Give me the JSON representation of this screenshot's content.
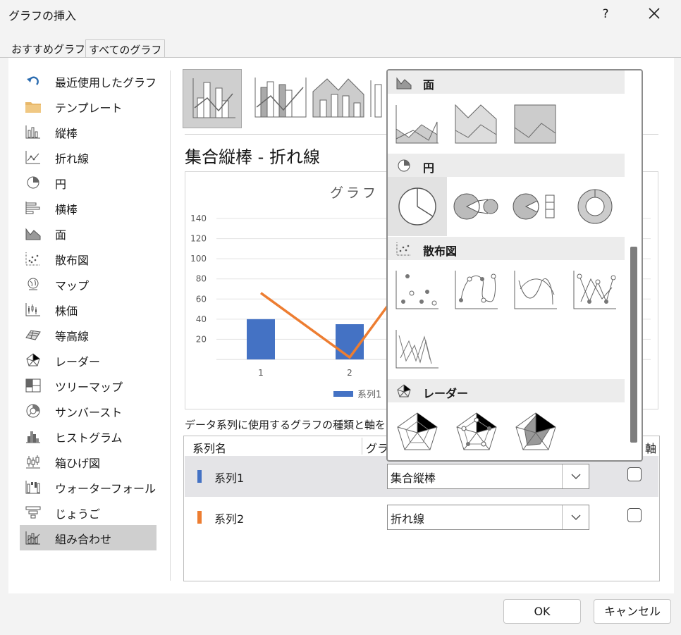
{
  "dialog": {
    "title": "グラフの挿入",
    "help": "?",
    "tabs": [
      "おすすめグラフ",
      "すべてのグラフ"
    ]
  },
  "sidebar": {
    "items": [
      {
        "label": "最近使用したグラフ",
        "icon": "recent-icon"
      },
      {
        "label": "テンプレート",
        "icon": "folder-icon"
      },
      {
        "label": "縦棒",
        "icon": "column-chart-icon"
      },
      {
        "label": "折れ線",
        "icon": "line-chart-icon"
      },
      {
        "label": "円",
        "icon": "pie-chart-icon"
      },
      {
        "label": "横棒",
        "icon": "bar-chart-icon"
      },
      {
        "label": "面",
        "icon": "area-chart-icon"
      },
      {
        "label": "散布図",
        "icon": "scatter-chart-icon"
      },
      {
        "label": "マップ",
        "icon": "map-chart-icon"
      },
      {
        "label": "株価",
        "icon": "stock-chart-icon"
      },
      {
        "label": "等高線",
        "icon": "surface-chart-icon"
      },
      {
        "label": "レーダー",
        "icon": "radar-chart-icon"
      },
      {
        "label": "ツリーマップ",
        "icon": "treemap-chart-icon"
      },
      {
        "label": "サンバースト",
        "icon": "sunburst-chart-icon"
      },
      {
        "label": "ヒストグラム",
        "icon": "histogram-chart-icon"
      },
      {
        "label": "箱ひげ図",
        "icon": "boxwhisker-chart-icon"
      },
      {
        "label": "ウォーターフォール",
        "icon": "waterfall-chart-icon"
      },
      {
        "label": "じょうご",
        "icon": "funnel-chart-icon"
      },
      {
        "label": "組み合わせ",
        "icon": "combo-chart-icon"
      }
    ],
    "selected": "組み合わせ"
  },
  "main": {
    "chart_type_title": "集合縦棒 - 折れ線",
    "series_caption": "データ系列に使用するグラフの種類と軸を",
    "table": {
      "headers": [
        "系列名",
        "グラ",
        "軸"
      ],
      "rows": [
        {
          "name": "系列1",
          "type": "集合縦棒",
          "color": "#4472c4"
        },
        {
          "name": "系列2",
          "type": "折れ線",
          "color": "#ed7d31"
        }
      ]
    }
  },
  "preview_chart": {
    "title": "グラフ タ",
    "legend": "系列1"
  },
  "chart_data": {
    "type": "bar",
    "categories": [
      "1",
      "2"
    ],
    "series": [
      {
        "name": "系列1",
        "type": "bar",
        "values": [
          40,
          35
        ]
      },
      {
        "type": "line",
        "values": [
          66,
          2
        ]
      }
    ],
    "yticks": [
      20,
      40,
      60,
      80,
      100,
      120,
      140
    ],
    "ylim": [
      0,
      140
    ]
  },
  "popup": {
    "sections": [
      {
        "label": "面",
        "icon": "area-chart-icon"
      },
      {
        "label": "円",
        "icon": "pie-chart-icon"
      },
      {
        "label": "散布図",
        "icon": "scatter-chart-icon"
      },
      {
        "label": "レーダー",
        "icon": "radar-chart-icon"
      }
    ]
  },
  "buttons": {
    "ok": "OK",
    "cancel": "キャンセル"
  }
}
